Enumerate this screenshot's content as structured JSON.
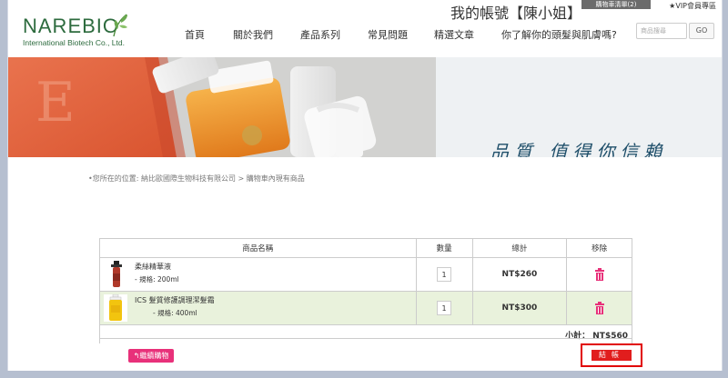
{
  "topbar": {
    "member_link": "我的帳號【陳小姐】",
    "cart_label": "購物車清單(2)",
    "vip_link": "★VIP會員專區"
  },
  "logo": {
    "text": "NAREBIO",
    "subtitle": "International Biotech Co., Ltd."
  },
  "nav": {
    "items": [
      "首頁",
      "關於我們",
      "產品系列",
      "常見問題",
      "精選文章",
      "你了解你的頭髮與肌膚嗎?"
    ]
  },
  "search": {
    "placeholder": "商品搜尋",
    "go_label": "GO"
  },
  "banner": {
    "slogan": "品質 值得你信賴"
  },
  "breadcrumb": "•您所在的位置: 納比歐國際生物科技有限公司 > 購物車內現有商品",
  "cart": {
    "headers": [
      "商品名稱",
      "數量",
      "總計",
      "移除"
    ],
    "items": [
      {
        "name": "柔絲精華液",
        "spec": "- 規格: 200ml",
        "qty": "1",
        "total": "NT$260"
      },
      {
        "name": "ICS 髮質修護調理潔髮霜",
        "spec": "- 規格: 400ml",
        "qty": "1",
        "total": "NT$300"
      }
    ],
    "subtotal": "小計： NT$560",
    "continue_label": "繼續購物",
    "checkout_label": "結帳"
  },
  "colors": {
    "brand_green": "#2d6b3e",
    "accent_pink": "#e8317a",
    "checkout_red": "#e11d1d",
    "row_highlight": "#e9f2dc"
  }
}
